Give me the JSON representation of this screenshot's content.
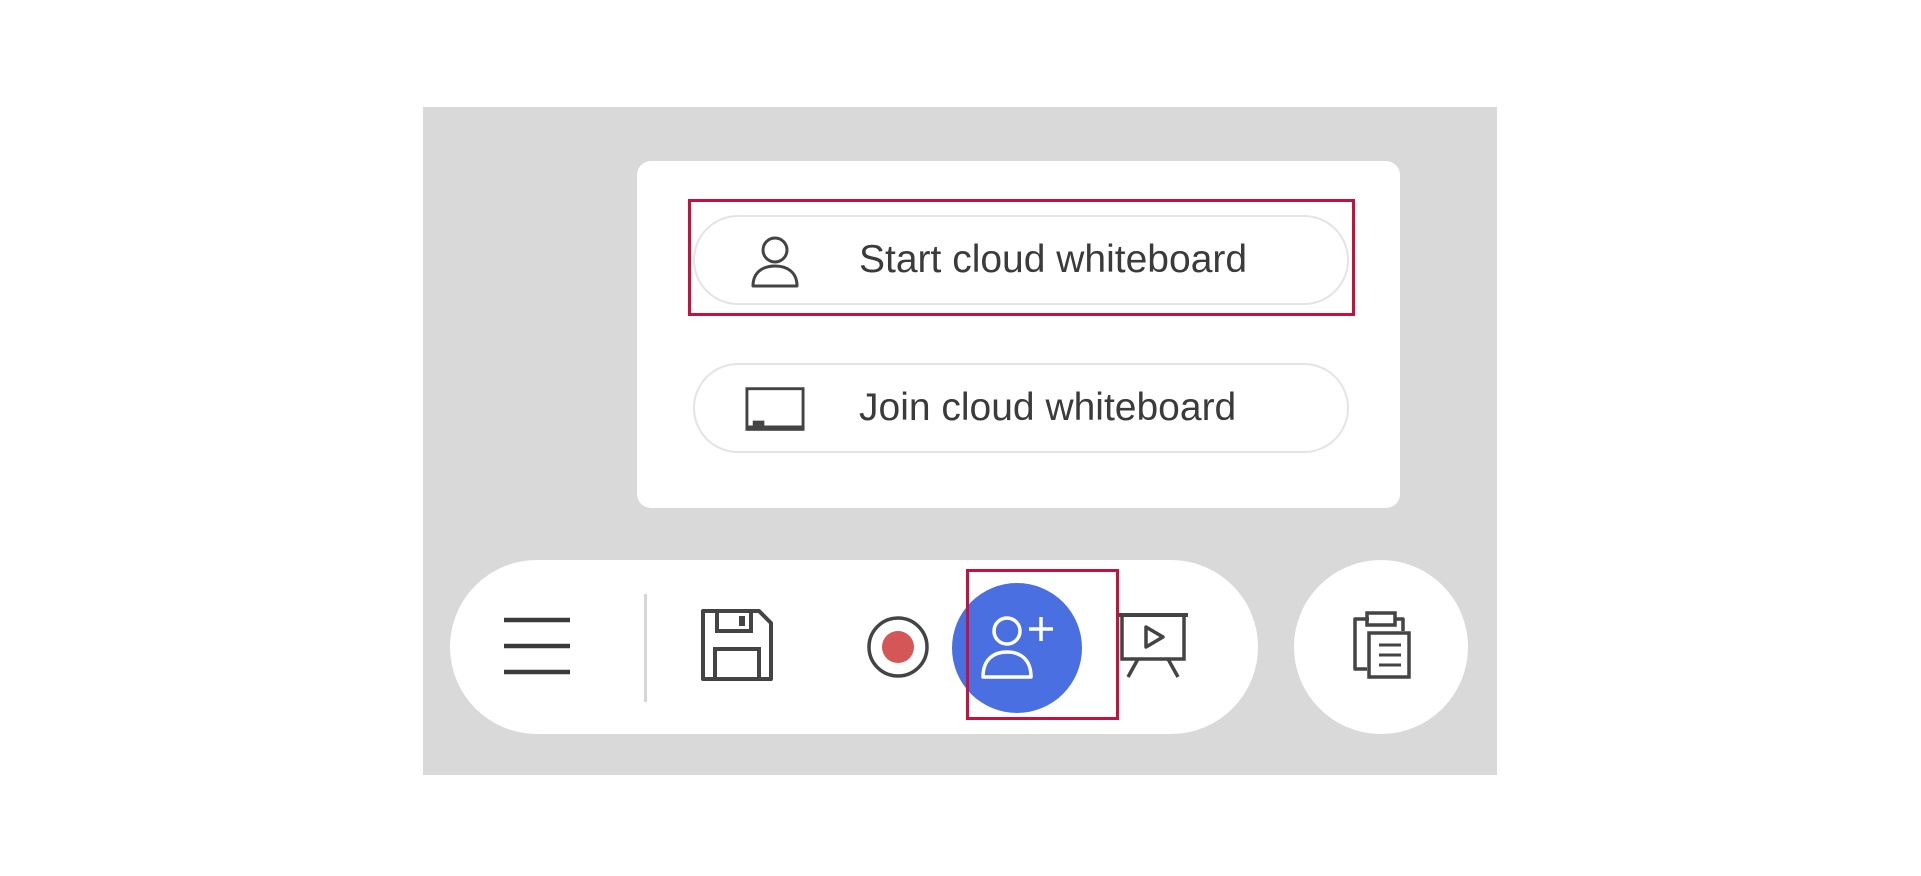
{
  "popup_menu": {
    "items": [
      {
        "label": "Start cloud whiteboard",
        "icon": "user-icon"
      },
      {
        "label": "Join cloud whiteboard",
        "icon": "board-icon"
      }
    ]
  },
  "toolbar": {
    "tools": [
      {
        "icon": "menu-icon"
      },
      {
        "icon": "save-icon"
      },
      {
        "icon": "record-icon"
      },
      {
        "icon": "add-user-icon"
      },
      {
        "icon": "presentation-icon"
      }
    ],
    "share_button_color": "#4a6fe0",
    "record_color": "#d45656"
  },
  "side_button": {
    "icon": "clipboard-icon"
  },
  "highlight_color": "#c8103e"
}
